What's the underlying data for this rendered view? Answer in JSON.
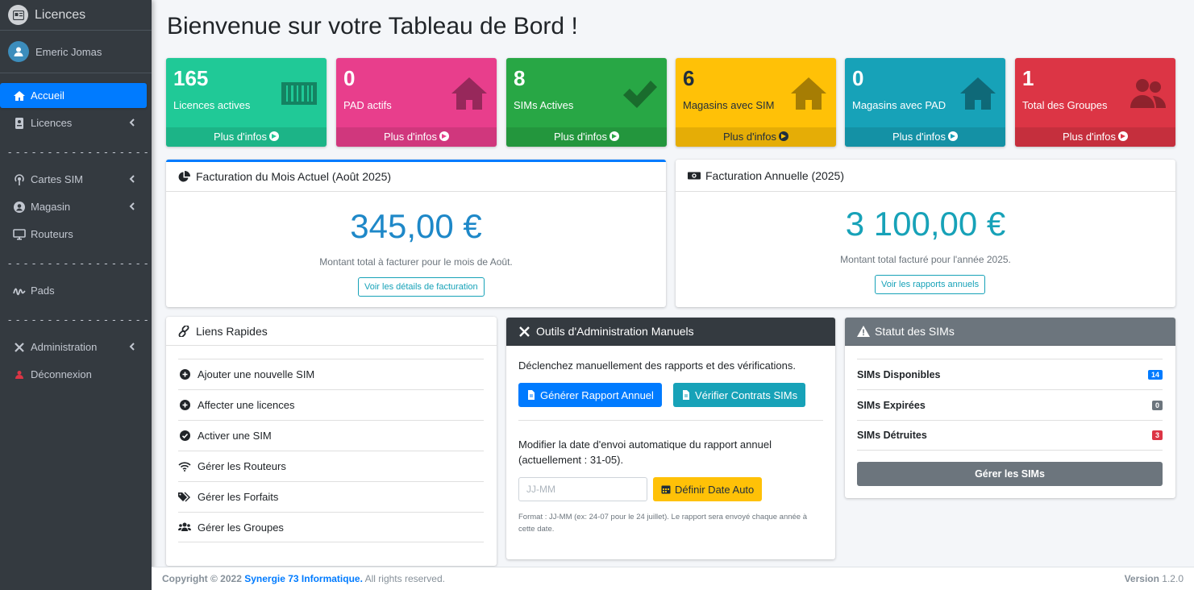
{
  "sidebar": {
    "brand": "Licences",
    "user": "Emeric Jomas",
    "separator": "- - - - - - - - - - - - - - - - - - -",
    "items": [
      {
        "label": "Accueil"
      },
      {
        "label": "Licences"
      },
      {
        "label": "Cartes SIM"
      },
      {
        "label": "Magasin"
      },
      {
        "label": "Routeurs"
      },
      {
        "label": "Pads"
      },
      {
        "label": "Administration"
      },
      {
        "label": "Déconnexion"
      }
    ]
  },
  "page": {
    "title": "Bienvenue sur votre Tableau de Bord !"
  },
  "stats": [
    {
      "value": "165",
      "label": "Licences actives",
      "more": "Plus d'infos",
      "color": "#20c997"
    },
    {
      "value": "0",
      "label": "PAD actifs",
      "more": "Plus d'infos",
      "color": "#e83e8c"
    },
    {
      "value": "8",
      "label": "SIMs Actives",
      "more": "Plus d'infos",
      "color": "#28a745"
    },
    {
      "value": "6",
      "label": "Magasins avec SIM",
      "more": "Plus d'infos",
      "color": "#ffc107"
    },
    {
      "value": "0",
      "label": "Magasins avec PAD",
      "more": "Plus d'infos",
      "color": "#17a2b8"
    },
    {
      "value": "1",
      "label": "Total des Groupes",
      "more": "Plus d'infos",
      "color": "#dc3545"
    }
  ],
  "monthly": {
    "title": "Facturation du Mois Actuel (Août 2025)",
    "amount": "345,00 €",
    "subtitle": "Montant total à facturer pour le mois de Août.",
    "button": "Voir les détails de facturation"
  },
  "annual": {
    "title": "Facturation Annuelle (2025)",
    "amount": "3 100,00 €",
    "subtitle": "Montant total facturé pour l'année 2025.",
    "button": "Voir les rapports annuels"
  },
  "quick_links": {
    "title": "Liens Rapides",
    "items": [
      {
        "label": "Ajouter une nouvelle SIM"
      },
      {
        "label": "Affecter une licences"
      },
      {
        "label": "Activer une SIM"
      },
      {
        "label": "Gérer les Routeurs"
      },
      {
        "label": "Gérer les Forfaits"
      },
      {
        "label": "Gérer les Groupes"
      }
    ]
  },
  "admin_tools": {
    "title": "Outils d'Administration Manuels",
    "description": "Déclenchez manuellement des rapports et des vérifications.",
    "btn_report": "Générer Rapport Annuel",
    "btn_verify": "Vérifier Contrats SIMs",
    "auto_text": "Modifier la date d'envoi automatique du rapport annuel (actuellement : 31-05).",
    "date_placeholder": "JJ-MM",
    "btn_set_date": "Définir Date Auto",
    "format_note": "Format : JJ-MM (ex: 24-07 pour le 24 juillet). Le rapport sera envoyé chaque année à cette date."
  },
  "sim_status": {
    "title": "Statut des SIMs",
    "rows": [
      {
        "label": "SIMs Disponibles",
        "count": "14"
      },
      {
        "label": "SIMs Expirées",
        "count": "0"
      },
      {
        "label": "SIMs Détruites",
        "count": "3"
      }
    ],
    "manage_button": "Gérer les SIMs"
  },
  "footer": {
    "copyright_prefix": "Copyright © 2022",
    "company": "Synergie 73 Informatique.",
    "rights": "All rights reserved.",
    "version_label": "Version",
    "version": "1.2.0"
  }
}
